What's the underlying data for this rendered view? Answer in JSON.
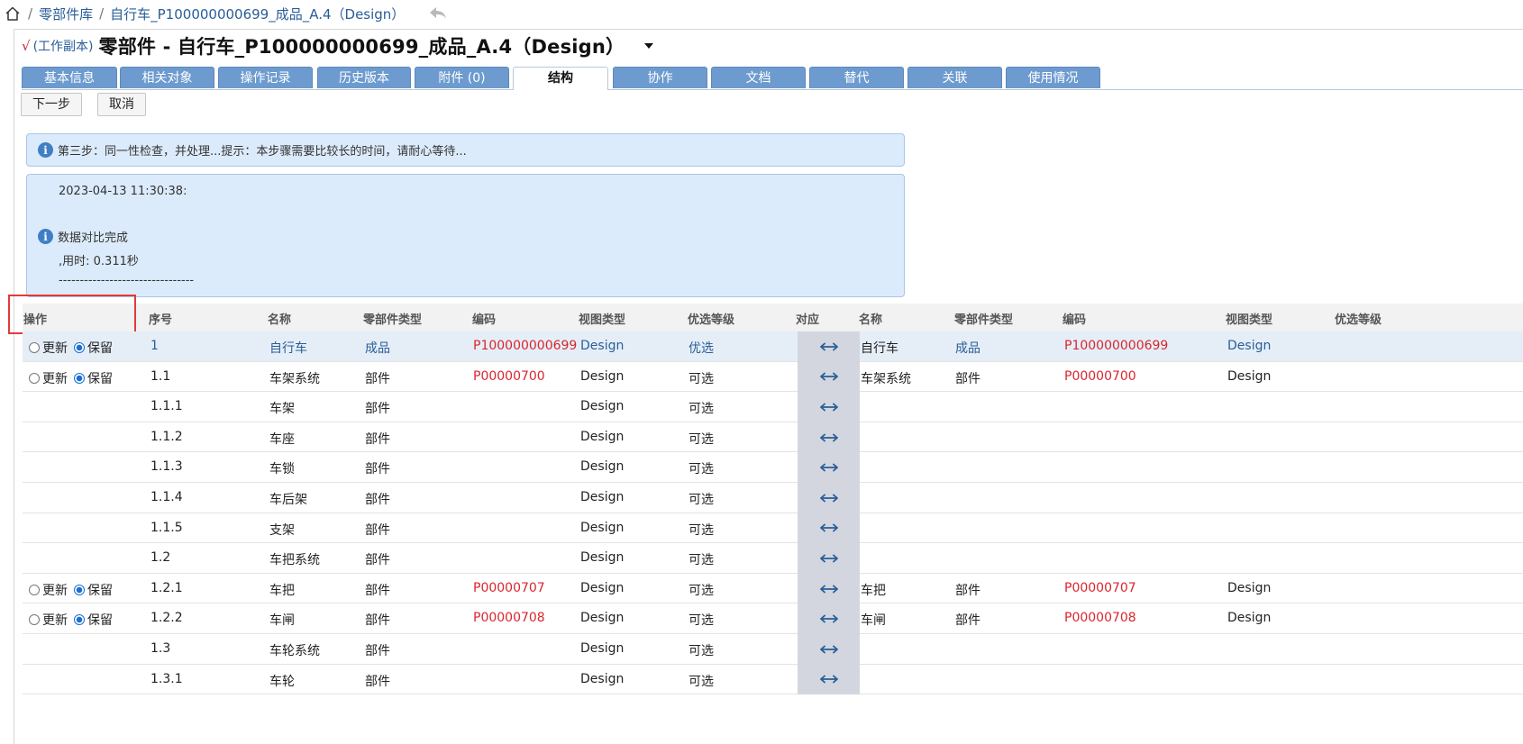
{
  "breadcrumb": {
    "sep": "/",
    "library": "零部件库",
    "current": "自行车_P100000000699_成品_A.4（Design）"
  },
  "header": {
    "check": "√",
    "working_copy": "(工作副本)",
    "title": "零部件 - 自行车_P100000000699_成品_A.4（Design）"
  },
  "tabs": [
    "基本信息",
    "相关对象",
    "操作记录",
    "历史版本",
    "附件 (0)",
    "结构",
    "协作",
    "文档",
    "替代",
    "关联",
    "使用情况"
  ],
  "active_tab": "结构",
  "toolbar": {
    "next": "下一步",
    "cancel": "取消"
  },
  "info": {
    "step": "第三步：同一性检查，并处理...提示：本步骤需要比较长的时间，请耐心等待...",
    "timestamp": "2023-04-13 11:30:38:",
    "done": "数据对比完成",
    "elapsed": ",用时: 0.311秒",
    "divider": "--------------------------------"
  },
  "columns": {
    "op": "操作",
    "seq": "序号",
    "name": "名称",
    "type": "零部件类型",
    "code": "编码",
    "view": "视图类型",
    "pref": "优选等级",
    "map": "对应",
    "name2": "名称",
    "type2": "零部件类型",
    "code2": "编码",
    "view2": "视图类型",
    "pref2": "优选等级"
  },
  "radio_labels": {
    "update": "更新",
    "keep": "保留"
  },
  "rows": [
    {
      "has_ops": true,
      "seq": "1",
      "name": "自行车",
      "type": "成品",
      "code": "P100000000699",
      "view": "Design",
      "pref": "优选",
      "name2": "自行车",
      "type2": "成品",
      "code2": "P100000000699",
      "view2": "Design"
    },
    {
      "has_ops": true,
      "seq": "1.1",
      "name": "车架系统",
      "type": "部件",
      "code": "P00000700",
      "view": "Design",
      "pref": "可选",
      "name2": "车架系统",
      "type2": "部件",
      "code2": "P00000700",
      "view2": "Design"
    },
    {
      "has_ops": false,
      "seq": "1.1.1",
      "name": "车架",
      "type": "部件",
      "code": "",
      "view": "Design",
      "pref": "可选",
      "name2": "",
      "type2": "",
      "code2": "",
      "view2": ""
    },
    {
      "has_ops": false,
      "seq": "1.1.2",
      "name": "车座",
      "type": "部件",
      "code": "",
      "view": "Design",
      "pref": "可选",
      "name2": "",
      "type2": "",
      "code2": "",
      "view2": ""
    },
    {
      "has_ops": false,
      "seq": "1.1.3",
      "name": "车锁",
      "type": "部件",
      "code": "",
      "view": "Design",
      "pref": "可选",
      "name2": "",
      "type2": "",
      "code2": "",
      "view2": ""
    },
    {
      "has_ops": false,
      "seq": "1.1.4",
      "name": "车后架",
      "type": "部件",
      "code": "",
      "view": "Design",
      "pref": "可选",
      "name2": "",
      "type2": "",
      "code2": "",
      "view2": ""
    },
    {
      "has_ops": false,
      "seq": "1.1.5",
      "name": "支架",
      "type": "部件",
      "code": "",
      "view": "Design",
      "pref": "可选",
      "name2": "",
      "type2": "",
      "code2": "",
      "view2": ""
    },
    {
      "has_ops": false,
      "seq": "1.2",
      "name": "车把系统",
      "type": "部件",
      "code": "",
      "view": "Design",
      "pref": "可选",
      "name2": "",
      "type2": "",
      "code2": "",
      "view2": ""
    },
    {
      "has_ops": true,
      "seq": "1.2.1",
      "name": "车把",
      "type": "部件",
      "code": "P00000707",
      "view": "Design",
      "pref": "可选",
      "name2": "车把",
      "type2": "部件",
      "code2": "P00000707",
      "view2": "Design"
    },
    {
      "has_ops": true,
      "seq": "1.2.2",
      "name": "车闸",
      "type": "部件",
      "code": "P00000708",
      "view": "Design",
      "pref": "可选",
      "name2": "车闸",
      "type2": "部件",
      "code2": "P00000708",
      "view2": "Design"
    },
    {
      "has_ops": false,
      "seq": "1.3",
      "name": "车轮系统",
      "type": "部件",
      "code": "",
      "view": "Design",
      "pref": "可选",
      "name2": "",
      "type2": "",
      "code2": "",
      "view2": ""
    },
    {
      "has_ops": false,
      "seq": "1.3.1",
      "name": "车轮",
      "type": "部件",
      "code": "",
      "view": "Design",
      "pref": "可选",
      "name2": "",
      "type2": "",
      "code2": "",
      "view2": ""
    }
  ],
  "icons": {
    "home": "home-icon",
    "back": "back-arrow-icon",
    "info": "info-icon",
    "map": "double-arrow-icon"
  },
  "colors": {
    "tab": "#6d9bcf",
    "link": "#2a5d98",
    "code": "#d9262e",
    "info_bg": "#dcebfb",
    "highlight": "#e23b3b"
  }
}
